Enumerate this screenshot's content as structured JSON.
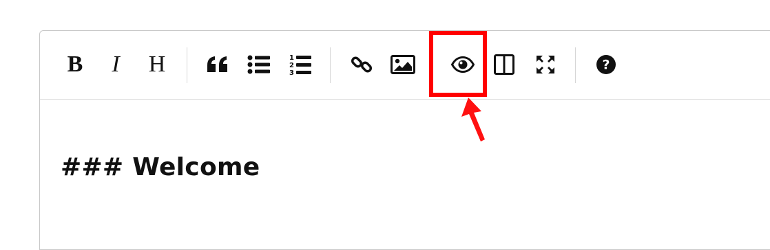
{
  "toolbar": {
    "bold_label": "B",
    "italic_label": "I",
    "heading_label": "H",
    "buttons": [
      {
        "name": "bold",
        "icon": "bold-icon"
      },
      {
        "name": "italic",
        "icon": "italic-icon"
      },
      {
        "name": "heading",
        "icon": "heading-icon"
      },
      {
        "name": "quote",
        "icon": "quote-icon"
      },
      {
        "name": "unordered-list",
        "icon": "bullet-list-icon"
      },
      {
        "name": "ordered-list",
        "icon": "numbered-list-icon"
      },
      {
        "name": "link",
        "icon": "link-icon"
      },
      {
        "name": "image",
        "icon": "image-icon"
      },
      {
        "name": "preview",
        "icon": "eye-icon"
      },
      {
        "name": "side-by-side",
        "icon": "columns-icon"
      },
      {
        "name": "fullscreen",
        "icon": "fullscreen-icon"
      },
      {
        "name": "guide",
        "icon": "help-icon"
      }
    ]
  },
  "editor": {
    "content": "### Welcome"
  },
  "annotation": {
    "highlight_color": "#ff0000",
    "target": "preview"
  }
}
